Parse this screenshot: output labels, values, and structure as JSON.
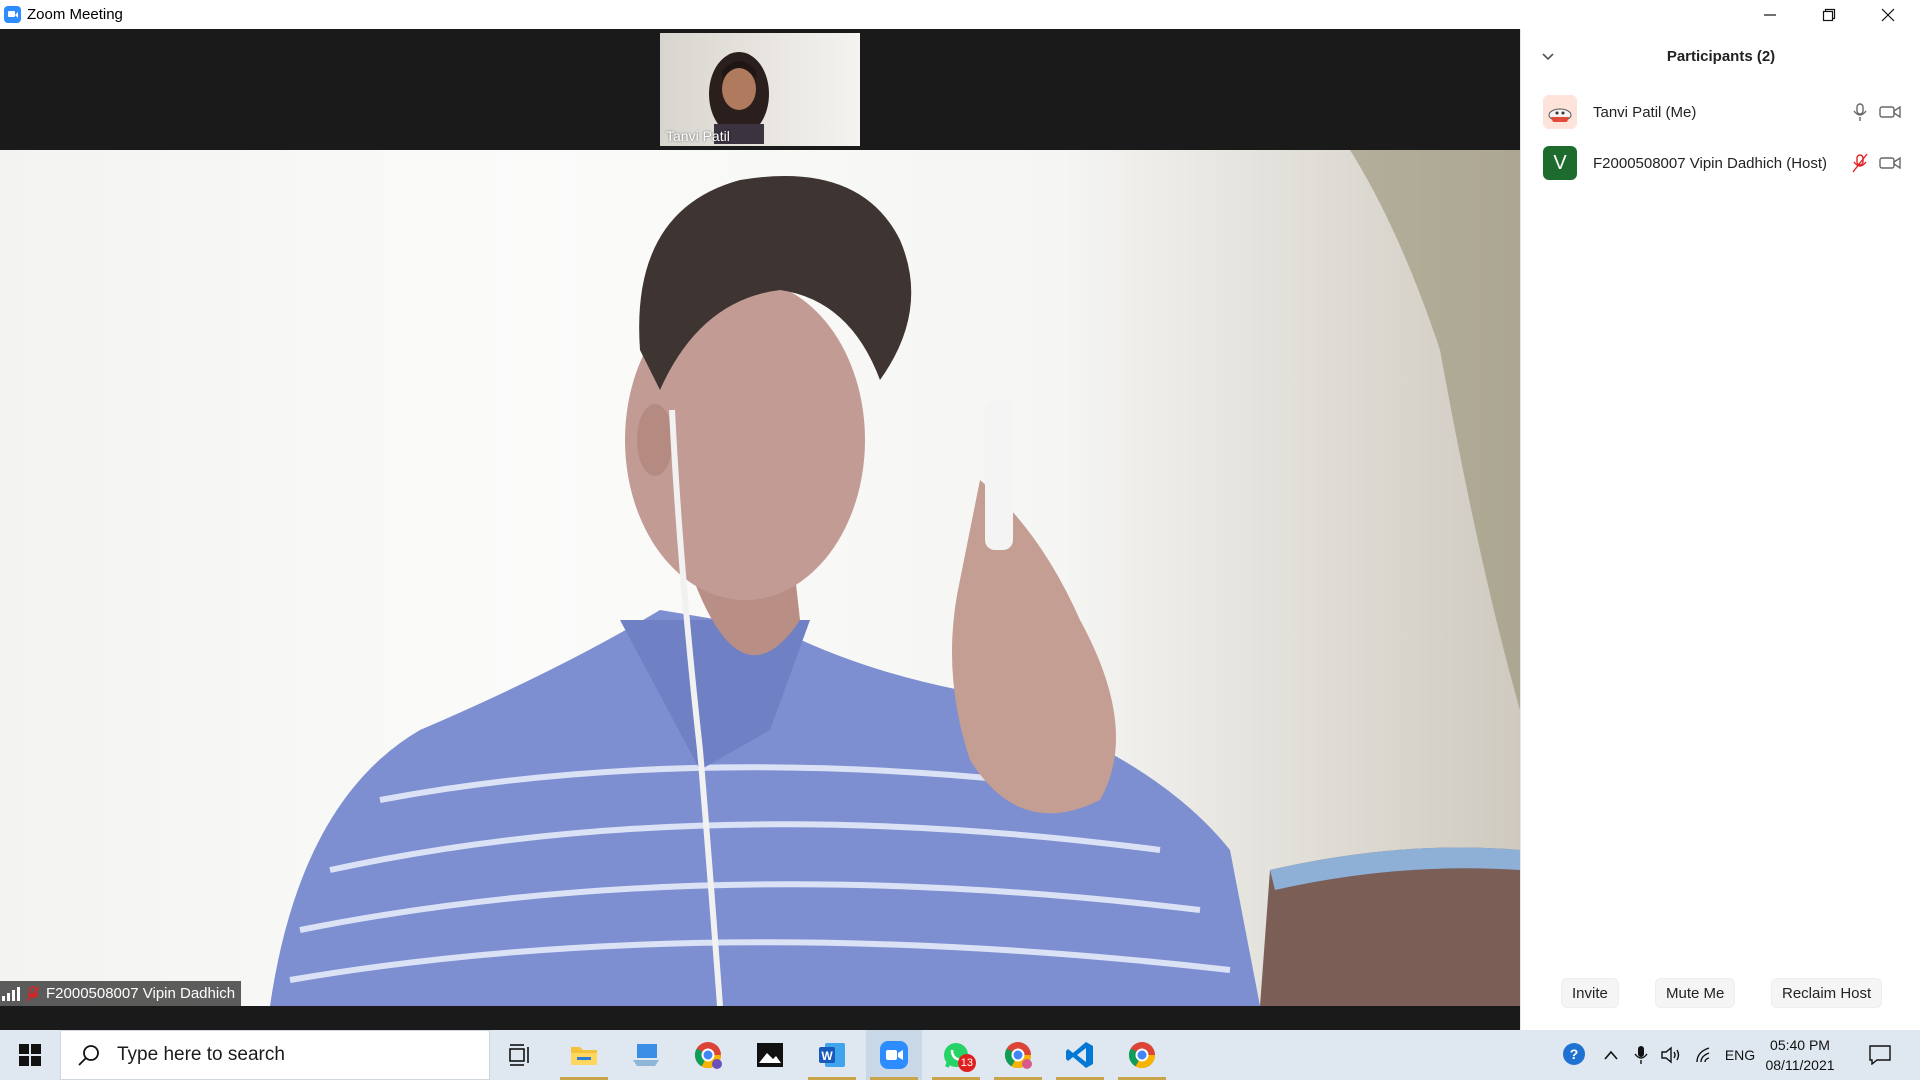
{
  "window": {
    "title": "Zoom Meeting",
    "controls": [
      "minimize",
      "restore",
      "close"
    ]
  },
  "video": {
    "thumbnail_name": "Tanvi Patil",
    "main_speaker_name": "F2000508007 Vipin Dadhich",
    "main_speaker_muted": true
  },
  "participants_panel": {
    "title": "Participants (2)",
    "participants": [
      {
        "name": "Tanvi Patil (Me)",
        "mic": "on",
        "camera": "on"
      },
      {
        "name": "F2000508007 Vipin Dadhich (Host)",
        "avatar_letter": "V",
        "mic": "muted",
        "camera": "on"
      }
    ],
    "buttons": {
      "invite": "Invite",
      "mute_me": "Mute Me",
      "reclaim_host": "Reclaim Host"
    }
  },
  "taskbar": {
    "search_placeholder": "Type here to search",
    "apps": [
      {
        "name": "task-view",
        "active": false
      },
      {
        "name": "file-explorer",
        "active": true
      },
      {
        "name": "this-pc",
        "active": false
      },
      {
        "name": "chrome-profile",
        "active": false
      },
      {
        "name": "photos",
        "active": false
      },
      {
        "name": "word",
        "active": true
      },
      {
        "name": "zoom",
        "active": true
      },
      {
        "name": "whatsapp",
        "active": true,
        "badge": "13"
      },
      {
        "name": "chrome-t",
        "active": true
      },
      {
        "name": "vscode",
        "active": true
      },
      {
        "name": "chrome",
        "active": true
      }
    ],
    "tray": {
      "language": "ENG",
      "time": "05:40 PM",
      "date": "08/11/2021"
    }
  },
  "colors": {
    "zoom_blue": "#2d8cff",
    "muted_red": "#e02020",
    "host_avatar_green": "#1e6b2e",
    "taskbar_bg": "#dfe8f0"
  }
}
